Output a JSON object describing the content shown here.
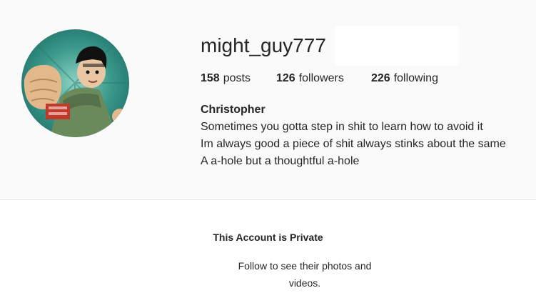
{
  "profile": {
    "username": "might_guy777",
    "follow_button_label": "",
    "stats": {
      "posts_count": "158",
      "posts_label": "posts",
      "followers_count": "126",
      "followers_label": "followers",
      "following_count": "226",
      "following_label": "following"
    },
    "full_name": "Christopher",
    "bio_lines": [
      "Sometimes you gotta step in shit to learn how to avoid it",
      "Im always good a piece of shit always stinks about the same",
      "A a-hole but a thoughtful a-hole"
    ],
    "avatar_icon": "profile-avatar-anime-character"
  },
  "private_notice": {
    "title": "This Account is Private",
    "message": "Follow to see their photos and videos."
  },
  "colors": {
    "header_bg": "#fafafa",
    "text": "#262626",
    "divider": "#e6e6e6",
    "avatar_bg": "#3b9a8c"
  }
}
